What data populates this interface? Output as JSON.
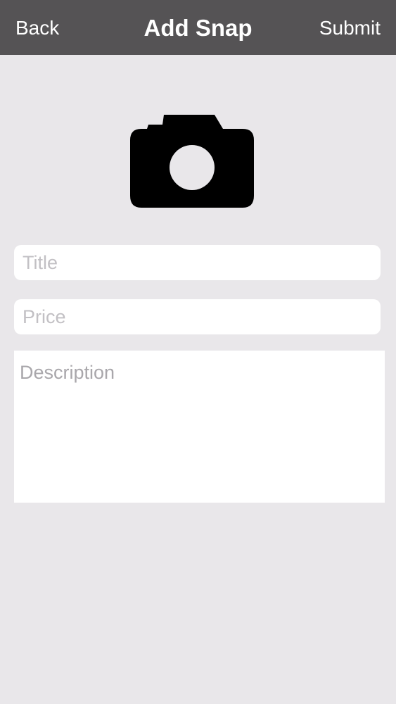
{
  "navbar": {
    "back_label": "Back",
    "title": "Add Snap",
    "submit_label": "Submit"
  },
  "photo": {
    "icon": "camera-icon"
  },
  "form": {
    "title_placeholder": "Title",
    "title_value": "",
    "price_placeholder": "Price",
    "price_value": "",
    "description_placeholder": "Description",
    "description_value": ""
  },
  "colors": {
    "navbar_background": "#555355",
    "page_background": "#e9e7ea",
    "field_background": "#ffffff",
    "placeholder_text": "#c2c0c4",
    "icon": "#000000"
  }
}
